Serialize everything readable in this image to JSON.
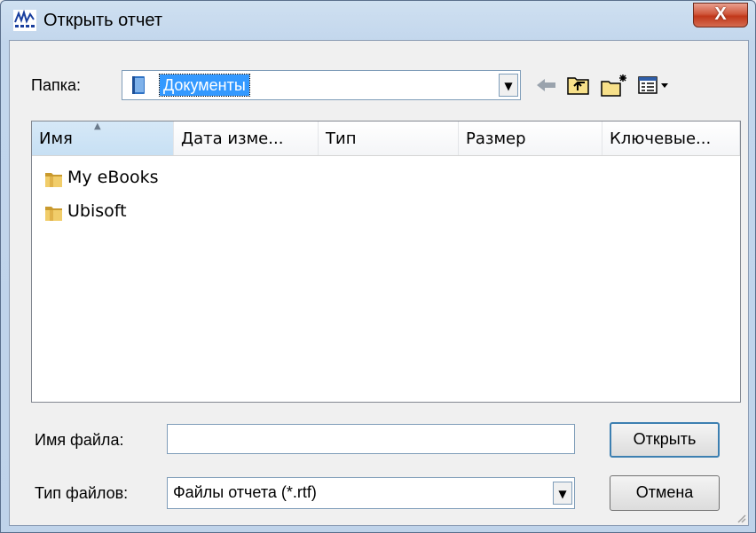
{
  "window": {
    "title": "Открыть отчет",
    "close_glyph": "X",
    "icon": "report-app-icon"
  },
  "folder_bar": {
    "label": "Папка:",
    "current_folder": "Документы",
    "folder_icon": "documents-library-icon",
    "toolbar": [
      {
        "name": "back-icon",
        "glyph": "⇐"
      },
      {
        "name": "up-folder-icon",
        "glyph": "⇑"
      },
      {
        "name": "new-folder-icon",
        "glyph": "✶"
      },
      {
        "name": "view-menu-icon",
        "glyph": "▤▾"
      }
    ]
  },
  "list": {
    "columns": [
      {
        "label": "Имя"
      },
      {
        "label": "Дата изме..."
      },
      {
        "label": "Тип"
      },
      {
        "label": "Размер"
      },
      {
        "label": "Ключевые..."
      }
    ],
    "sorted_column": "Имя",
    "items": [
      {
        "name": "My eBooks",
        "icon": "folder-icon"
      },
      {
        "name": "Ubisoft",
        "icon": "folder-icon"
      }
    ]
  },
  "form": {
    "filename_label": "Имя файла:",
    "filename_value": "",
    "filetype_label": "Тип файлов:",
    "filetype_value": "Файлы отчета (*.rtf)",
    "open_button": "Открыть",
    "cancel_button": "Отмена"
  },
  "colors": {
    "selection": "#3399ff",
    "close_button": "#c1381b",
    "folder": "#e8b84a"
  }
}
